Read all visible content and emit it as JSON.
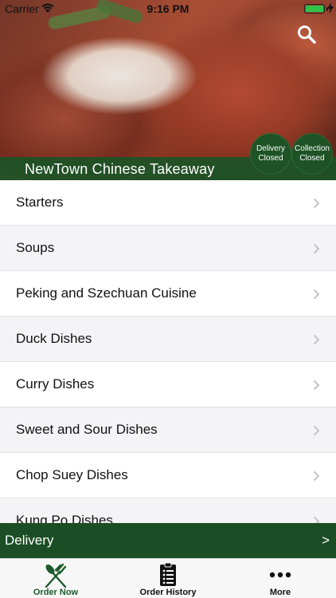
{
  "status_bar": {
    "carrier": "Carrier",
    "time": "9:16 PM",
    "battery_level": 1.0
  },
  "header": {
    "restaurant_name": "NewTown Chinese Takeaway",
    "delivery_status": [
      "Delivery",
      "Closed"
    ],
    "collection_status": [
      "Collection",
      "Closed"
    ],
    "icons": {
      "search": "search-icon"
    }
  },
  "menu": {
    "items": [
      {
        "label": "Starters"
      },
      {
        "label": "Soups"
      },
      {
        "label": "Peking and Szechuan Cuisine"
      },
      {
        "label": "Duck Dishes"
      },
      {
        "label": "Curry Dishes"
      },
      {
        "label": "Sweet and Sour Dishes"
      },
      {
        "label": "Chop Suey Dishes"
      },
      {
        "label": "Kung Po Dishes"
      }
    ]
  },
  "order_type_bar": {
    "label": "Delivery",
    "arrow": ">"
  },
  "tabbar": {
    "tabs": [
      {
        "label": "Order Now",
        "icon": "fork-knife-icon",
        "active": true
      },
      {
        "label": "Order History",
        "icon": "receipt-icon",
        "active": false
      },
      {
        "label": "More",
        "icon": "more-dots-icon",
        "active": false
      }
    ]
  },
  "colors": {
    "brand_green": "#1b4e24",
    "active_tab": "#1b5a2a",
    "battery": "#30c24a"
  }
}
